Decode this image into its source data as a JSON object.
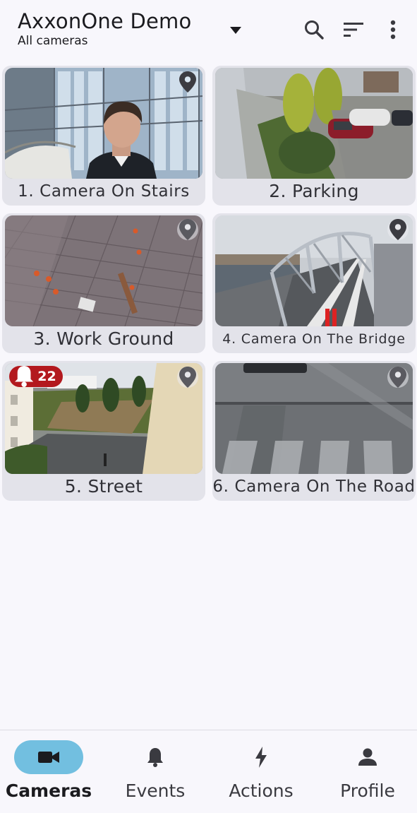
{
  "header": {
    "title": "AxxonOne Demo",
    "subtitle": "All cameras",
    "icons": [
      "dropdown-arrow-icon",
      "search-icon",
      "filter-sort-icon",
      "more-vertical-icon"
    ]
  },
  "cameras": [
    {
      "label": "1. Camera On Stairs",
      "has_pin": true,
      "pin_style": "plain"
    },
    {
      "label": "2. Parking",
      "has_pin": false
    },
    {
      "label": "3. Work Ground",
      "has_pin": true
    },
    {
      "label": "4. Camera On The Bridge",
      "has_pin": true
    },
    {
      "label": "5. Street",
      "has_pin": true,
      "alarm_count": "22"
    },
    {
      "label": "6. Camera On The Road",
      "has_pin": true
    }
  ],
  "bottom_nav": {
    "items": [
      {
        "label": "Cameras",
        "icon": "video-camera-icon",
        "active": true
      },
      {
        "label": "Events",
        "icon": "bell-icon",
        "active": false
      },
      {
        "label": "Actions",
        "icon": "lightning-icon",
        "active": false
      },
      {
        "label": "Profile",
        "icon": "person-icon",
        "active": false
      }
    ]
  },
  "colors": {
    "background": "#f8f7fc",
    "card": "#e3e3ea",
    "active_pill": "#72bfe0",
    "alarm": "#b3191e"
  }
}
